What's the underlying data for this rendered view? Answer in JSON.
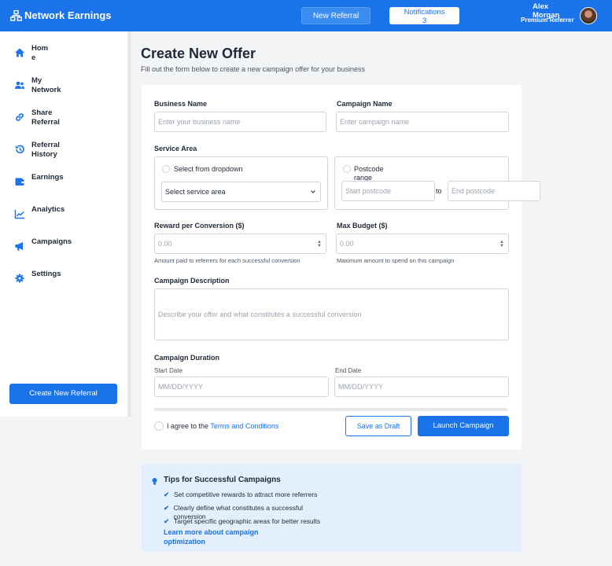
{
  "header": {
    "brand": "Network Earnings",
    "new_referral": "New Referral",
    "notifications_label": "Notifications",
    "notifications_count": "3",
    "user_first": "Alex",
    "user_last": "Morgan",
    "user_role": "Premium Referrer"
  },
  "sidebar": {
    "items": [
      {
        "l1": "Hom",
        "l2": "e",
        "icon": "home-icon"
      },
      {
        "l1": "My",
        "l2": "Network",
        "icon": "users-icon"
      },
      {
        "l1": "Share",
        "l2": "Referral",
        "icon": "link-icon"
      },
      {
        "l1": "Referral",
        "l2": "History",
        "icon": "history-icon"
      },
      {
        "l1": "Earnings",
        "l2": "",
        "icon": "wallet-icon"
      },
      {
        "l1": "Analytics",
        "l2": "",
        "icon": "chart-icon"
      },
      {
        "l1": "Campaigns",
        "l2": "",
        "icon": "megaphone-icon"
      },
      {
        "l1": "Settings",
        "l2": "",
        "icon": "gear-icon"
      }
    ],
    "create_button": "Create New Referral"
  },
  "main": {
    "title": "Create New Offer",
    "subtitle": "Fill out the form below to create a new campaign offer for your business"
  },
  "form": {
    "business_name_label": "Business Name",
    "business_name_placeholder": "Enter your business name",
    "campaign_name_label": "Campaign Name",
    "campaign_name_placeholder": "Enter campaign name",
    "service_area_label": "Service Area",
    "dropdown_option": "Select from dropdown",
    "select_value": "Select service area",
    "postcode_option_l1": "Postcode",
    "postcode_option_l2": "range",
    "start_postcode": "Start postcode",
    "to": "to",
    "end_postcode": "End postcode",
    "reward_label": "Reward per Conversion ($)",
    "reward_value": "0.00",
    "reward_help": "Amount paid to referrers for each successful conversion",
    "budget_label": "Max Budget ($)",
    "budget_value": "0.00",
    "budget_help": "Maximum amount to spend on this campaign",
    "description_label": "Campaign Description",
    "description_placeholder": "Describe your offer and what constitutes a successful conversion",
    "duration_label": "Campaign Duration",
    "start_date_label": "Start Date",
    "start_date_placeholder": "MM/DD/YYYY",
    "end_date_label": "End Date",
    "end_date_placeholder": "MM/DD/YYYY",
    "agree_text": "I agree to the ",
    "terms_link": "Terms and Conditions",
    "save_draft": "Save as Draft",
    "launch": "Launch Campaign"
  },
  "tips": {
    "title": "Tips for Successful Campaigns",
    "items": [
      "Set competitive rewards to attract more referrers",
      "Clearly define what constitutes a successful conversion",
      "Target specific geographic areas for better results"
    ],
    "link": "Learn more about campaign optimization"
  },
  "colors": {
    "primary": "#1a73e8",
    "tips_bg": "#e3effd"
  }
}
